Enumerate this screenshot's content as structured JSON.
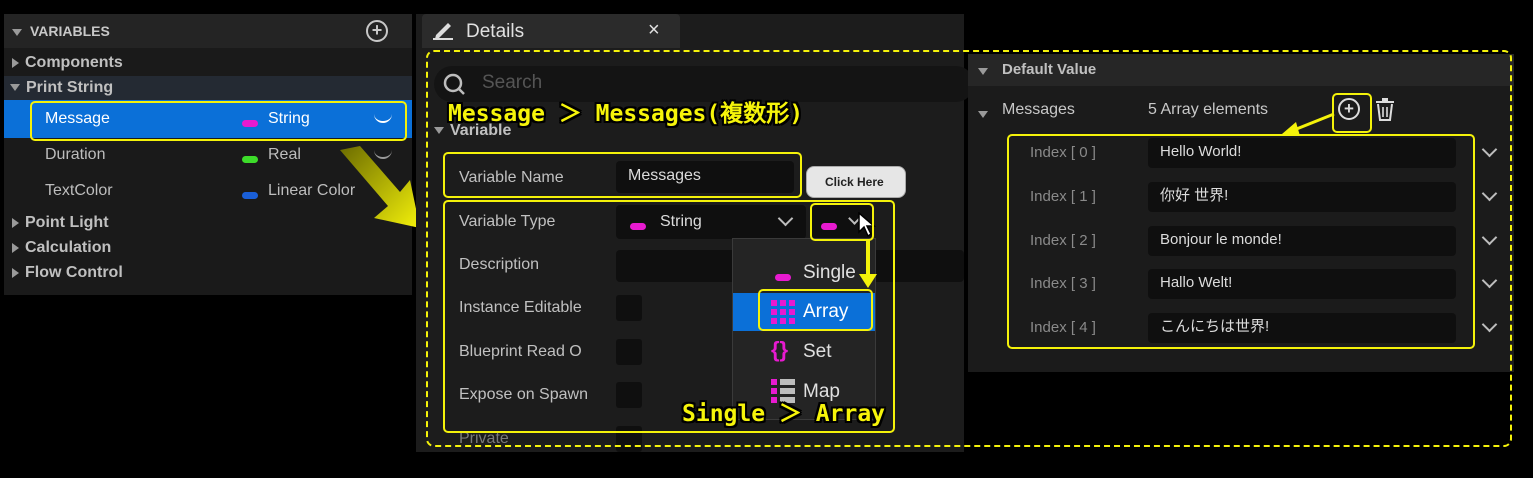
{
  "variables_panel": {
    "header": "VARIABLES",
    "categories": {
      "components": "Components",
      "print_string": "Print String",
      "point_light": "Point Light",
      "calculation": "Calculation",
      "flow_control": "Flow Control"
    },
    "rows": [
      {
        "name": "Message",
        "type": "String",
        "color": "#e81ad0"
      },
      {
        "name": "Duration",
        "type": "Real",
        "color": "#3ddc2a"
      },
      {
        "name": "TextColor",
        "type": "Linear Color",
        "color": "#1a5fd8"
      }
    ]
  },
  "details": {
    "tab_title": "Details",
    "search_placeholder": "Search",
    "section": "Variable",
    "labels": {
      "variable_name": "Variable Name",
      "variable_type": "Variable Type",
      "description": "Description",
      "instance_editable": "Instance Editable",
      "blueprint_read_only": "Blueprint Read O",
      "expose_on_spawn": "Expose on Spawn",
      "private": "Private"
    },
    "variable_name_value": "Messages",
    "variable_type_value": "String",
    "container_menu": [
      "Single",
      "Array",
      "Set",
      "Map"
    ],
    "tooltip": "Click Here"
  },
  "default_value": {
    "header": "Default Value",
    "array_name": "Messages",
    "element_count": "5 Array elements",
    "elements": [
      {
        "index": "Index [ 0 ]",
        "value": "Hello World!"
      },
      {
        "index": "Index [ 1 ]",
        "value": "你好 世界!"
      },
      {
        "index": "Index [ 2 ]",
        "value": "Bonjour le monde!"
      },
      {
        "index": "Index [ 3 ]",
        "value": "Hallo Welt!"
      },
      {
        "index": "Index [ 4 ]",
        "value": "こんにちは世界!"
      }
    ]
  },
  "annotations": {
    "rename": "Message ＞ Messages(複数形)",
    "container": "Single ＞ Array"
  },
  "colors": {
    "highlight": "#f4f20a",
    "selection": "#0b70d8",
    "string_pin": "#e81ad0"
  }
}
